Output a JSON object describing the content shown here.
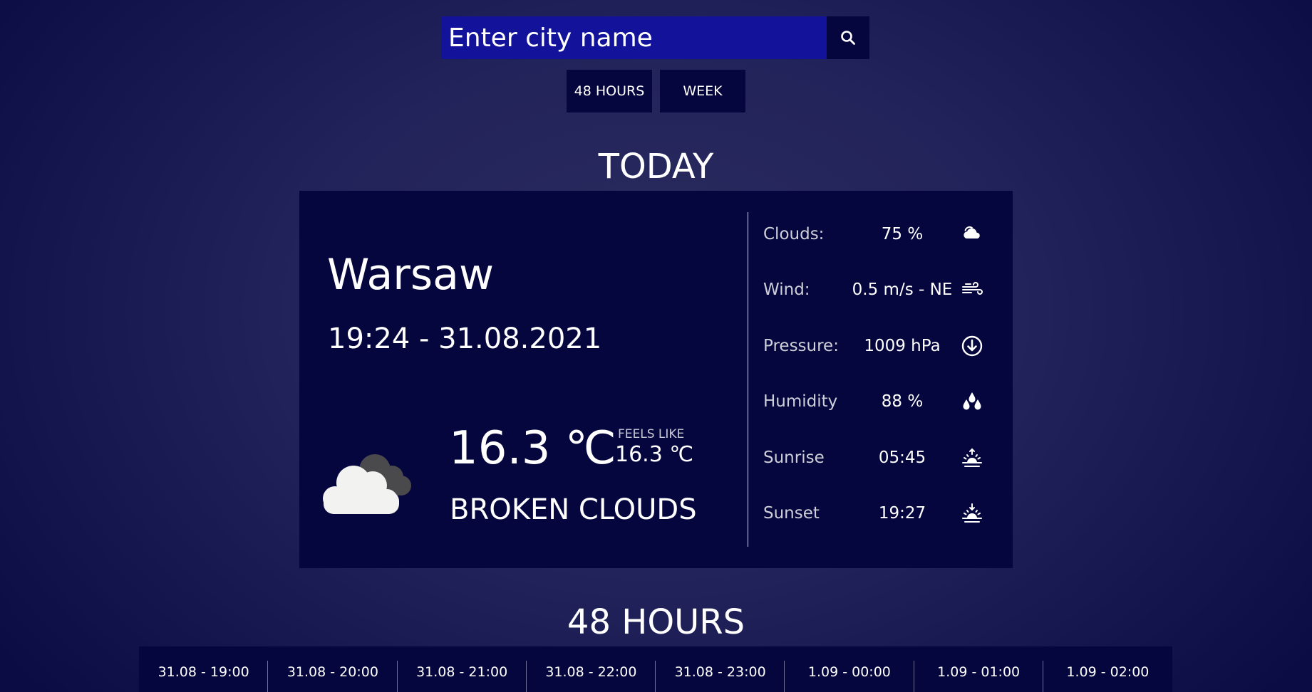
{
  "search": {
    "placeholder": "Enter city name",
    "button_icon": "search-icon"
  },
  "period_buttons": {
    "hours_label": "48 HOURS",
    "week_label": "WEEK"
  },
  "sections": {
    "today_title": "TODAY",
    "hours_title": "48 HOURS"
  },
  "today": {
    "city": "Warsaw",
    "datetime": "19:24 - 31.08.2021",
    "temperature": "16.3 ℃",
    "feels_like_label": "FEELS LIKE",
    "feels_like_value": "16.3 ℃",
    "description": "BROKEN CLOUDS",
    "weather_icon": "broken-clouds-icon",
    "details": [
      {
        "label": "Clouds:",
        "value": "75 %",
        "icon": "cloud-icon"
      },
      {
        "label": "Wind:",
        "value": "0.5 m/s - NE",
        "icon": "wind-icon"
      },
      {
        "label": "Pressure:",
        "value": "1009 hPa",
        "icon": "pressure-down-icon"
      },
      {
        "label": "Humidity",
        "value": "88 %",
        "icon": "humidity-drops-icon"
      },
      {
        "label": "Sunrise",
        "value": "05:45",
        "icon": "sunrise-icon"
      },
      {
        "label": "Sunset",
        "value": "19:27",
        "icon": "sunset-icon"
      }
    ]
  },
  "hours": [
    "31.08 - 19:00",
    "31.08 - 20:00",
    "31.08 - 21:00",
    "31.08 - 22:00",
    "31.08 - 23:00",
    "1.09 - 00:00",
    "1.09 - 01:00",
    "1.09 - 02:00"
  ],
  "colors": {
    "background": "#22235a",
    "card": "#05063d",
    "search_input": "#12129a"
  }
}
